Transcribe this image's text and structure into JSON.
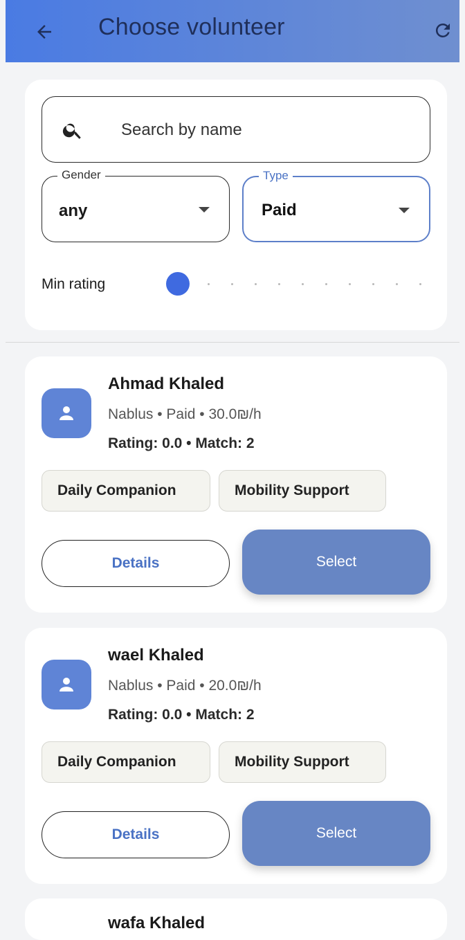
{
  "header": {
    "title": "Choose volunteer",
    "back_icon": "arrow-left-icon",
    "refresh_icon": "refresh-icon"
  },
  "filters": {
    "search": {
      "placeholder": "Search by name",
      "value": ""
    },
    "gender": {
      "label": "Gender",
      "value": "any"
    },
    "type": {
      "label": "Type",
      "value": "Paid"
    },
    "min_rating": {
      "label": "Min rating",
      "value": 0
    }
  },
  "volunteers": [
    {
      "name": "Ahmad Khaled",
      "meta": "Nablus • Paid • 30.0₪/h",
      "stats": "Rating: 0.0  •  Match: 2",
      "tags": [
        "Daily Companion",
        "Mobility Support"
      ],
      "details_label": "Details",
      "select_label": "Select"
    },
    {
      "name": "wael Khaled",
      "meta": "Nablus • Paid • 20.0₪/h",
      "stats": "Rating: 0.0  •  Match: 2",
      "tags": [
        "Daily Companion",
        "Mobility Support"
      ],
      "details_label": "Details",
      "select_label": "Select"
    },
    {
      "name": "wafa Khaled"
    }
  ],
  "colors": {
    "appbar_start": "#4a7be3",
    "appbar_end": "#6f8fd0",
    "accent": "#3f6ae0",
    "select_button": "#6786c4",
    "avatar": "#5f84d6"
  }
}
